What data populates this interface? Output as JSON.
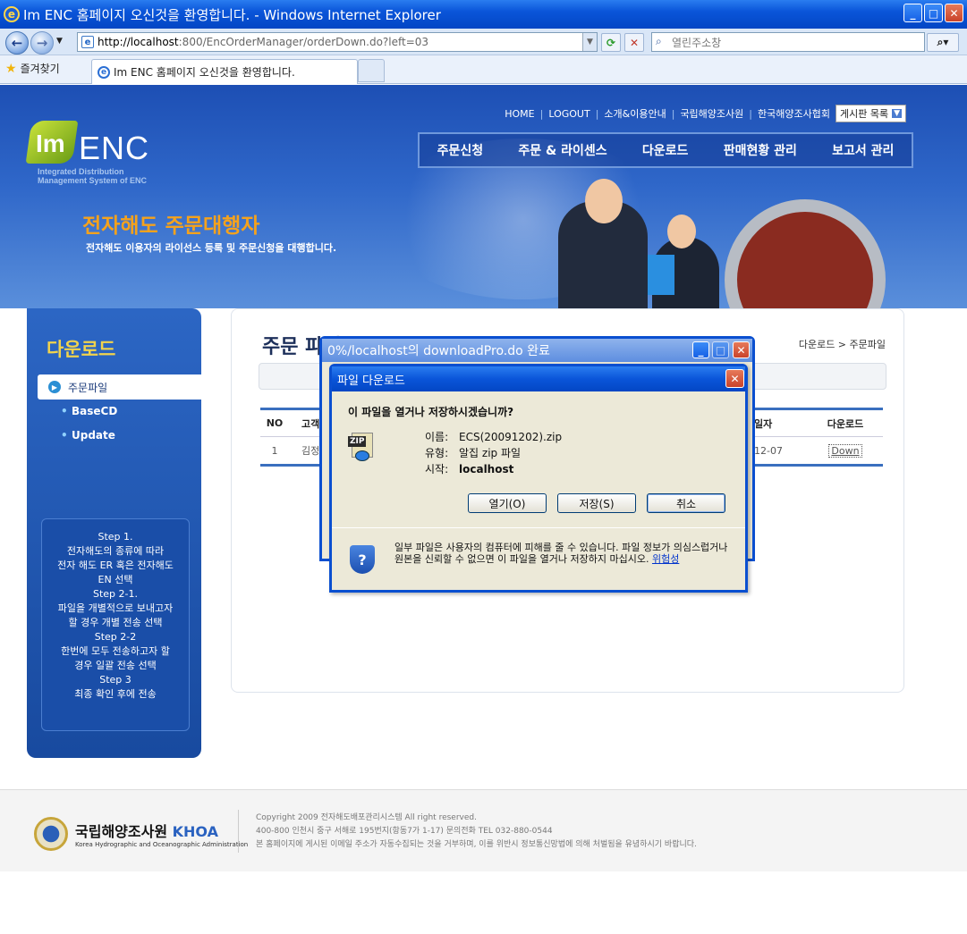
{
  "window": {
    "title": "Im ENC 홈페이지 오신것을 환영합니다. - Windows Internet Explorer"
  },
  "browser": {
    "address_host": "http://localhost",
    "address_rest": ":800/EncOrderManager/orderDown.do?left=03",
    "search_placeholder": "열린주소창",
    "favorites_label": "즐겨찾기",
    "tab_title": "Im ENC 홈페이지 오신것을 환영합니다."
  },
  "header": {
    "top_links": [
      "HOME",
      "LOGOUT",
      "소개&이용안내",
      "국립해양조사원",
      "한국해양조사협회"
    ],
    "board_select": "게시판 목록",
    "nav": [
      "주문신청",
      "주문 & 라이센스",
      "다운로드",
      "판매현황 관리",
      "보고서 관리"
    ],
    "logo_im": "Im",
    "logo_enc": "ENC",
    "logo_sub1": "Integrated Distribution",
    "logo_sub2": "Management System of ENC",
    "hero_title": "전자해도 주문대행자",
    "hero_sub": "전자해도 이용자의 라이선스 등록 및 주문신청을 대행합니다."
  },
  "sidebar": {
    "title": "다운로드",
    "active": "주문파일",
    "items": [
      "BaseCD",
      "Update"
    ],
    "steps": [
      "Step 1.",
      "전자해도의 종류에 따라",
      "전자 해도 ER 혹은 전자해도",
      "EN 선택",
      "Step 2-1.",
      "파일을 개별적으로 보내고자",
      "할 경우 개별 전송 선택",
      "Step 2-2",
      "한번에 모두 전송하고자 할",
      "경우 일괄 전송 선택",
      "Step 3",
      "최종 확인 후에 전송"
    ]
  },
  "content": {
    "title": "주문 파일",
    "breadcrumb": "다운로드 > 주문파일",
    "table": {
      "headers": [
        "NO",
        "고객",
        "일자",
        "다운로드"
      ],
      "rows": [
        {
          "no": "1",
          "customer": "김정",
          "date": "12-07",
          "download": "Down"
        }
      ]
    }
  },
  "footer": {
    "org_name": "국립해양조사원",
    "org_abbr": "KHOA",
    "org_en": "Korea Hydrographic and Oceanographic Administration",
    "copyright": "Copyright  2009 전자해도배포관리시스템 All right reserved.",
    "address": "400-800 인천시 중구 서해로 195번지(항동7가 1-17)  문의전화 TEL 032-880-0544",
    "notice": "본 홈페이지에 게시된 이메일 주소가 자동수집되는 것을 거부하며, 이를 위반시 정보통신망법에 의해 처벌됨을 유념하시기 바랍니다."
  },
  "progress_dialog": {
    "title": "0%/localhost의 downloadPro.do 완료"
  },
  "download_dialog": {
    "title": "파일 다운로드",
    "question": "이 파일을 열거나 저장하시겠습니까?",
    "name_label": "이름:",
    "name_value": "ECS(20091202).zip",
    "type_label": "유형:",
    "type_value": "알집 zip 파일",
    "from_label": "시작:",
    "from_value": "localhost",
    "open_button": "열기(O)",
    "save_button": "저장(S)",
    "cancel_button": "취소",
    "warning": "일부 파일은 사용자의 컴퓨터에 피해를 줄 수 있습니다. 파일 정보가 의심스럽거나 원본을 신뢰할 수 없으면 이 파일을 열거나 저장하지 마십시오.",
    "warning_link": "위험성"
  },
  "icons": [
    "ie-icon",
    "back-arrow-icon",
    "forward-arrow-icon",
    "refresh-icon",
    "stop-icon",
    "search-icon",
    "star-icon",
    "zip-file-icon",
    "shield-icon",
    "close-icon"
  ]
}
